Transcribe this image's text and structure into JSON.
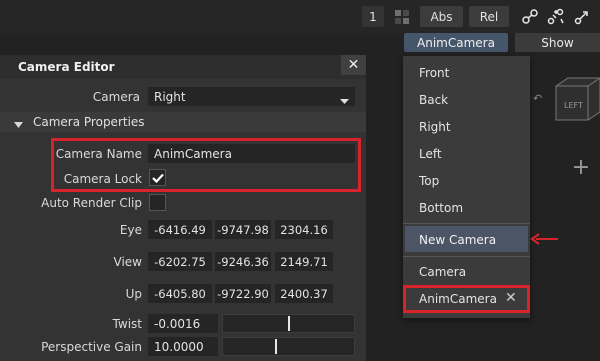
{
  "toolbar": {
    "number": "1",
    "abs_label": "Abs",
    "rel_label": "Rel"
  },
  "viewport": {
    "camera_button": "AnimCamera",
    "show_button": "Show",
    "add_glyph": "+",
    "cube_label": "LEFT"
  },
  "panel": {
    "title": "Camera Editor",
    "camera_label": "Camera",
    "camera_value": "Right",
    "section_title": "Camera Properties",
    "camera_name_label": "Camera Name",
    "camera_name_value": "AnimCamera",
    "camera_lock_label": "Camera Lock",
    "camera_lock_checked": true,
    "auto_render_clip_label": "Auto Render Clip",
    "auto_render_clip_checked": false,
    "eye_label": "Eye",
    "eye": [
      "-6416.49",
      "-9747.98",
      "2304.16"
    ],
    "view_label": "View",
    "view": [
      "-6202.75",
      "-9246.36",
      "2149.71"
    ],
    "up_label": "Up",
    "up": [
      "-6405.80",
      "-9722.90",
      "2400.37"
    ],
    "twist_label": "Twist",
    "twist_value": "-0.0016",
    "twist_slider_level": 0.5,
    "perspective_gain_label": "Perspective Gain",
    "perspective_gain_value": "10.0000",
    "perspective_gain_slider_level": 0.4
  },
  "menu": {
    "items": [
      "Front",
      "Back",
      "Right",
      "Left",
      "Top",
      "Bottom"
    ],
    "new_camera": "New Camera",
    "camera_header": "Camera",
    "anim_camera": "AnimCamera"
  },
  "colors": {
    "highlight_red": "#d9232a",
    "accent_blue": "#45556a"
  }
}
